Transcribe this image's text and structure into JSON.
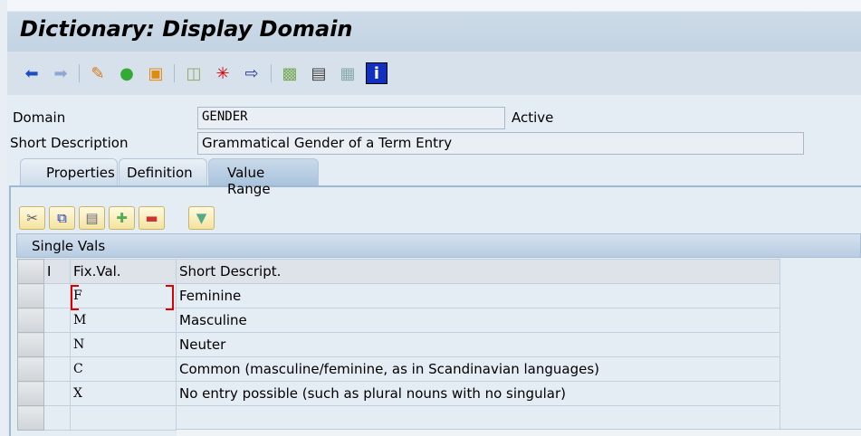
{
  "window": {
    "title": "Dictionary: Display Domain"
  },
  "toolbar": {
    "icons": [
      "back-icon",
      "forward-icon",
      "display-change-icon",
      "active-inactive-icon",
      "other-object-icon",
      "check-icon",
      "activate-icon",
      "where-used-icon",
      "object-list-icon",
      "navigation-window-icon",
      "display-object-list-icon",
      "info-icon"
    ]
  },
  "header": {
    "domain_label": "Domain",
    "domain_value": "GENDER",
    "status": "Active",
    "short_desc_label": "Short Description",
    "short_desc_value": "Grammatical Gender of a Term Entry"
  },
  "tabs": [
    {
      "label": "Properties",
      "active": false
    },
    {
      "label": "Definition",
      "active": false
    },
    {
      "label": "Value Range",
      "active": true
    }
  ],
  "grid": {
    "title": "Single Vals",
    "columns": [
      "I",
      "Fix.Val.",
      "Short Descript."
    ],
    "rows": [
      {
        "i": "",
        "fix_val": "F",
        "desc": "Feminine"
      },
      {
        "i": "",
        "fix_val": "M",
        "desc": "Masculine"
      },
      {
        "i": "",
        "fix_val": "N",
        "desc": "Neuter"
      },
      {
        "i": "",
        "fix_val": "C",
        "desc": "Common (masculine/feminine, as in Scandinavian languages)"
      },
      {
        "i": "",
        "fix_val": "X",
        "desc": "No entry possible (such as plural nouns with no singular)"
      },
      {
        "i": "",
        "fix_val": "",
        "desc": ""
      }
    ]
  }
}
